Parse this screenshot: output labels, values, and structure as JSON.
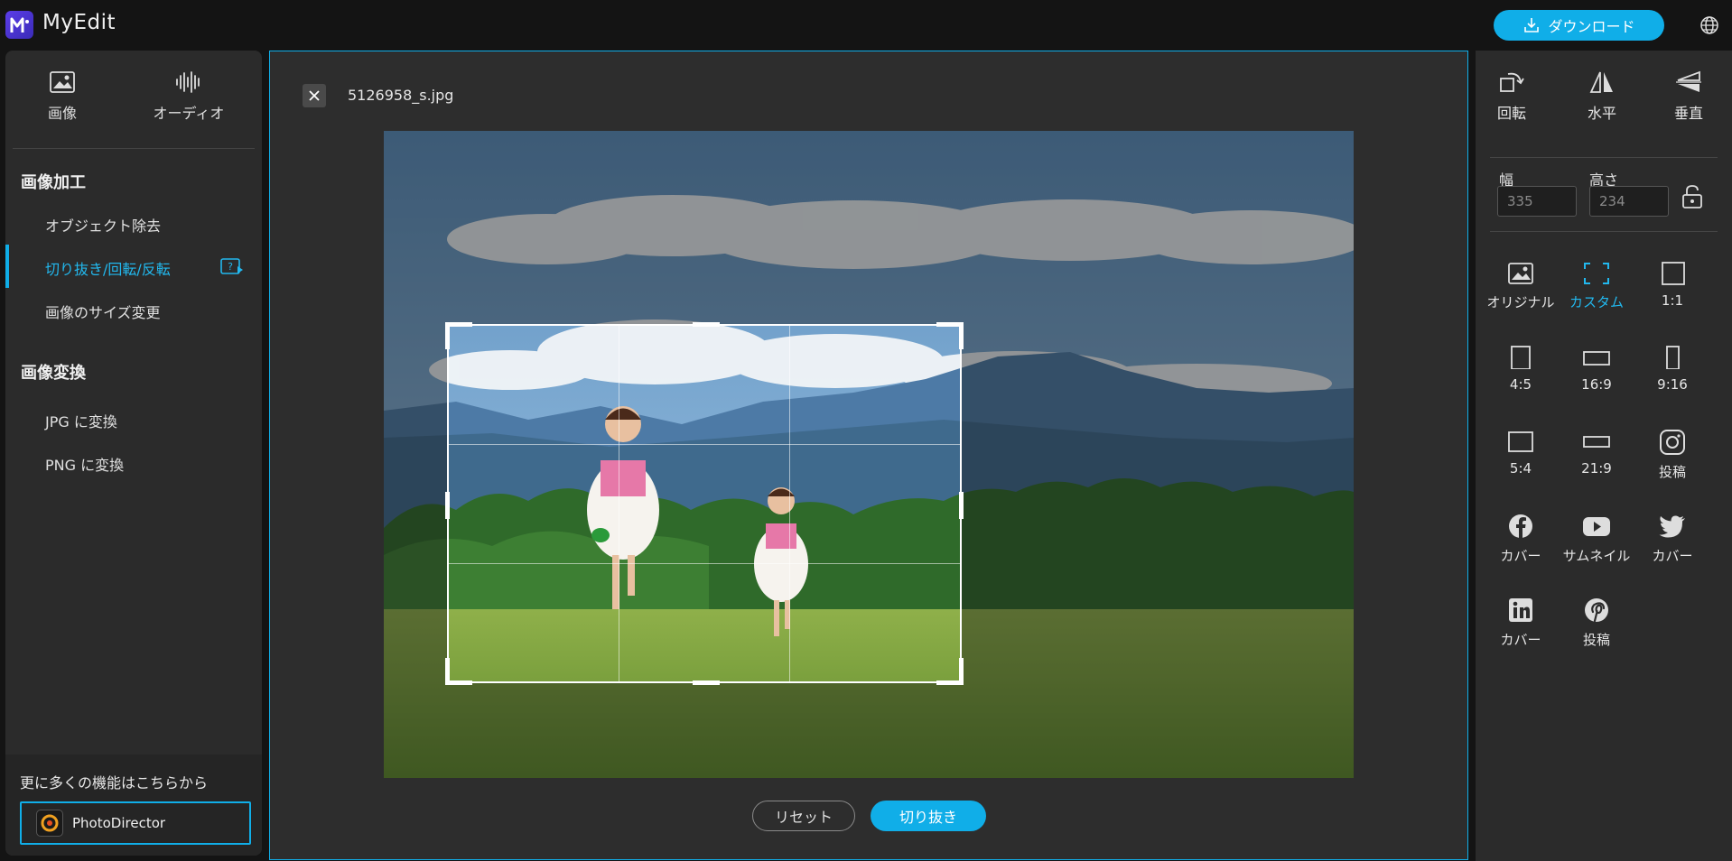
{
  "app": {
    "title": "MyEdit",
    "download_label": "ダウンロード"
  },
  "sidebar": {
    "media_tabs": [
      {
        "label": "画像",
        "icon": "image-icon"
      },
      {
        "label": "オーディオ",
        "icon": "audio-wave-icon"
      }
    ],
    "section1_title": "画像加工",
    "section1_items": [
      "オブジェクト除去",
      "切り抜き/回転/反転",
      "画像のサイズ変更"
    ],
    "active_item": "切り抜き/回転/反転",
    "section2_title": "画像変換",
    "section2_items": [
      "JPG に変換",
      "PNG に変換"
    ],
    "more_text": "更に多くの機能はこちらから",
    "photodirector_label": "PhotoDirector"
  },
  "workspace": {
    "file_name": "5126958_s.jpg",
    "reset_label": "リセット",
    "crop_label": "切り抜き"
  },
  "right_panel": {
    "tools": [
      {
        "label": "回転",
        "icon": "rotate-icon"
      },
      {
        "label": "水平",
        "icon": "flip-horizontal-icon"
      },
      {
        "label": "垂直",
        "icon": "flip-vertical-icon"
      }
    ],
    "width_label": "幅",
    "height_label": "高さ",
    "width_value": "335",
    "height_value": "234",
    "ratios": [
      {
        "label": "オリジナル",
        "icon": "original-image-icon"
      },
      {
        "label": "カスタム",
        "icon": "custom-crop-icon"
      },
      {
        "label": "1:1",
        "icon": "square-icon"
      },
      {
        "label": "4:5",
        "icon": "portrait-rect-icon"
      },
      {
        "label": "16:9",
        "icon": "wide-rect-icon"
      },
      {
        "label": "9:16",
        "icon": "tall-rect-icon"
      },
      {
        "label": "5:4",
        "icon": "landscape-rect-icon"
      },
      {
        "label": "21:9",
        "icon": "ultrawide-rect-icon"
      },
      {
        "label": "投稿",
        "icon": "instagram-icon"
      },
      {
        "label": "カバー",
        "icon": "facebook-icon"
      },
      {
        "label": "サムネイル",
        "icon": "youtube-icon"
      },
      {
        "label": "カバー",
        "icon": "twitter-icon"
      },
      {
        "label": "カバー",
        "icon": "linkedin-icon"
      },
      {
        "label": "投稿",
        "icon": "pinterest-icon"
      }
    ],
    "active_ratio": "カスタム"
  },
  "colors": {
    "accent": "#10aee8",
    "background": "#141414",
    "panel": "#2b2b2b"
  }
}
